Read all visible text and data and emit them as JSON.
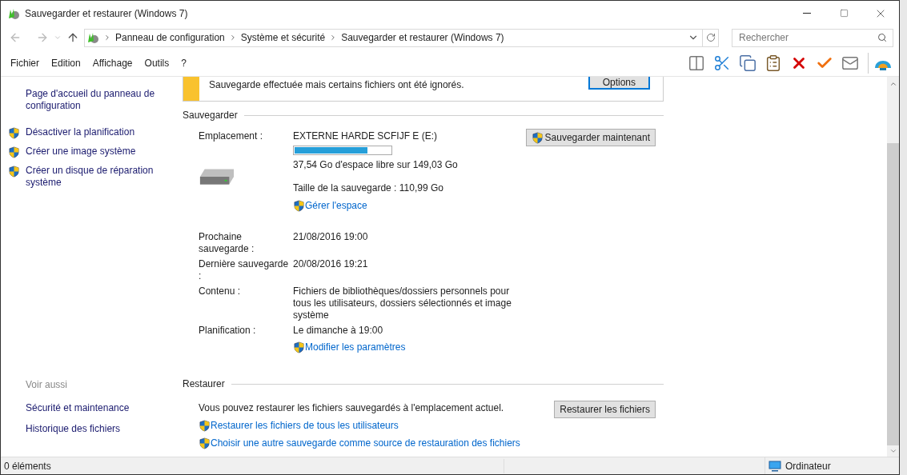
{
  "window": {
    "title": "Sauvegarder et restaurer (Windows 7)"
  },
  "address_bar": {
    "breadcrumbs": [
      "Panneau de configuration",
      "Système et sécurité",
      "Sauvegarder et restaurer (Windows 7)"
    ],
    "search_placeholder": "Rechercher"
  },
  "menu": [
    "Fichier",
    "Edition",
    "Affichage",
    "Outils",
    "?"
  ],
  "sidebar": {
    "links": [
      {
        "label": "Page d'accueil du panneau de configuration",
        "shield": false
      },
      {
        "label": "Désactiver la planification",
        "shield": true
      },
      {
        "label": "Créer une image système",
        "shield": true
      },
      {
        "label": "Créer un disque de réparation système",
        "shield": true
      }
    ],
    "see_also_title": "Voir aussi",
    "see_also": [
      "Sécurité et maintenance",
      "Historique des fichiers"
    ]
  },
  "banner": {
    "text": "Sauvegarde effectuée mais certains fichiers ont été ignorés.",
    "button": "Options"
  },
  "backup": {
    "heading": "Sauvegarder",
    "button": "Sauvegarder maintenant",
    "location": {
      "label": "Emplacement :",
      "drive": "EXTERNE HARDE SCFIJF E (E:)",
      "level": 0.76,
      "free": "37,54 Go d'espace libre sur 149,03 Go",
      "size": "Taille de la sauvegarde : 110,99 Go",
      "link": "Gérer l'espace"
    },
    "rows": [
      {
        "label": "Prochaine sauvegarde :",
        "value": "21/08/2016 19:00"
      },
      {
        "label": "Dernière sauvegarde :",
        "value": "20/08/2016 19:21"
      },
      {
        "label": "Contenu :",
        "value": "Fichiers de bibliothèques/dossiers personnels pour tous les utilisateurs, dossiers sélectionnés et image système"
      },
      {
        "label": "Planification :",
        "value": "Le dimanche à 19:00",
        "link": "Modifier les paramètres"
      }
    ]
  },
  "restore": {
    "heading": "Restaurer",
    "text": "Vous pouvez restaurer les fichiers sauvegardés à l'emplacement actuel.",
    "button": "Restaurer les fichiers",
    "links": [
      "Restaurer les fichiers de tous les utilisateurs",
      "Choisir une autre sauvegarde comme source de restauration des fichiers"
    ]
  },
  "status_bar": {
    "items": "0 éléments",
    "location": "Ordinateur"
  }
}
